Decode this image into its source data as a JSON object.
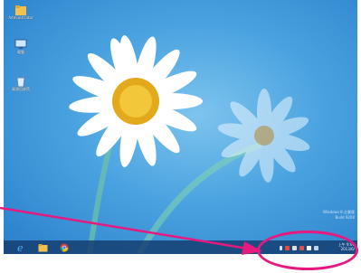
{
  "desktop_icons": [
    {
      "icon": "folder-icon",
      "label": "Administrator"
    },
    {
      "icon": "computer-icon",
      "label": "電腦"
    },
    {
      "icon": "recycle-bin-icon",
      "label": "資源回收筒"
    }
  ],
  "taskbar": {
    "pinned": [
      {
        "icon": "internet-explorer-icon"
      },
      {
        "icon": "file-explorer-icon"
      },
      {
        "icon": "chrome-icon"
      }
    ],
    "tray_icons": [
      "chevron-up-icon",
      "flag-icon",
      "network-icon",
      "speaker-icon",
      "input-icon",
      "keyboard-icon"
    ],
    "clock": {
      "time": "上午 9:00",
      "date": "2013/6/"
    }
  },
  "watermark": {
    "line1": "Windows 8 企業版",
    "line2": "Build 9200"
  },
  "colors": {
    "highlight": "#e6197e",
    "taskbar": "#143c6e",
    "sky": "#4aa3e0"
  }
}
